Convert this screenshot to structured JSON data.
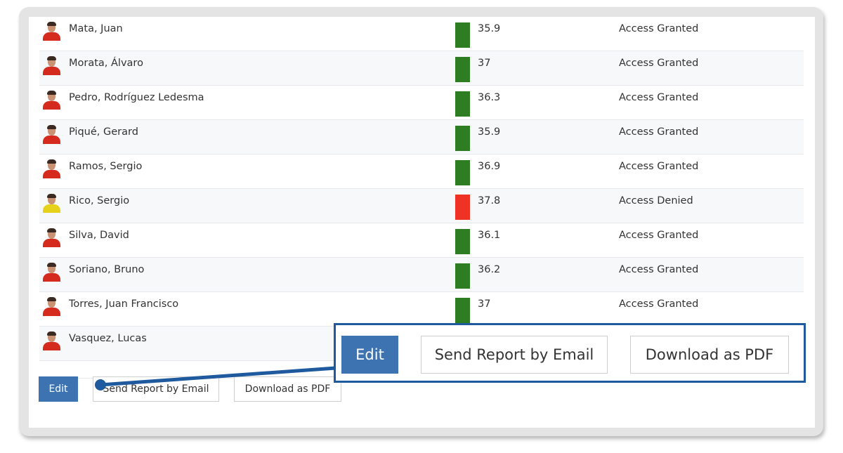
{
  "rows": [
    {
      "name": "Mata, Juan",
      "temperature": "35.9",
      "status": "Access Granted",
      "indicator": "granted",
      "avatar": "player-photo"
    },
    {
      "name": "Morata, Álvaro",
      "temperature": "37",
      "status": "Access Granted",
      "indicator": "granted",
      "avatar": "player-photo"
    },
    {
      "name": "Pedro, Rodríguez Ledesma",
      "temperature": "36.3",
      "status": "Access Granted",
      "indicator": "granted",
      "avatar": "player-photo"
    },
    {
      "name": "Piqué, Gerard",
      "temperature": "35.9",
      "status": "Access Granted",
      "indicator": "granted",
      "avatar": "player-photo"
    },
    {
      "name": "Ramos, Sergio",
      "temperature": "36.9",
      "status": "Access Granted",
      "indicator": "granted",
      "avatar": "player-photo"
    },
    {
      "name": "Rico, Sergio",
      "temperature": "37.8",
      "status": "Access Denied",
      "indicator": "denied",
      "avatar": "goalkeeper-photo"
    },
    {
      "name": "Silva, David",
      "temperature": "36.1",
      "status": "Access Granted",
      "indicator": "granted",
      "avatar": "player-photo"
    },
    {
      "name": "Soriano, Bruno",
      "temperature": "36.2",
      "status": "Access Granted",
      "indicator": "granted",
      "avatar": "player-photo"
    },
    {
      "name": "Torres, Juan Francisco",
      "temperature": "37",
      "status": "Access Granted",
      "indicator": "granted",
      "avatar": "player-photo"
    },
    {
      "name": "Vasquez, Lucas",
      "temperature": "",
      "status": "",
      "indicator": "none",
      "avatar": "player-photo"
    }
  ],
  "colors": {
    "granted": "#2f7d22",
    "denied": "#ee3224",
    "primary": "#3d73b1",
    "callout": "#1f5a9e"
  },
  "actions": {
    "edit_label": "Edit",
    "email_label": "Send Report by Email",
    "pdf_label": "Download as PDF"
  },
  "callout": {
    "edit_label": "Edit",
    "email_label": "Send Report by Email",
    "pdf_label": "Download as PDF"
  }
}
